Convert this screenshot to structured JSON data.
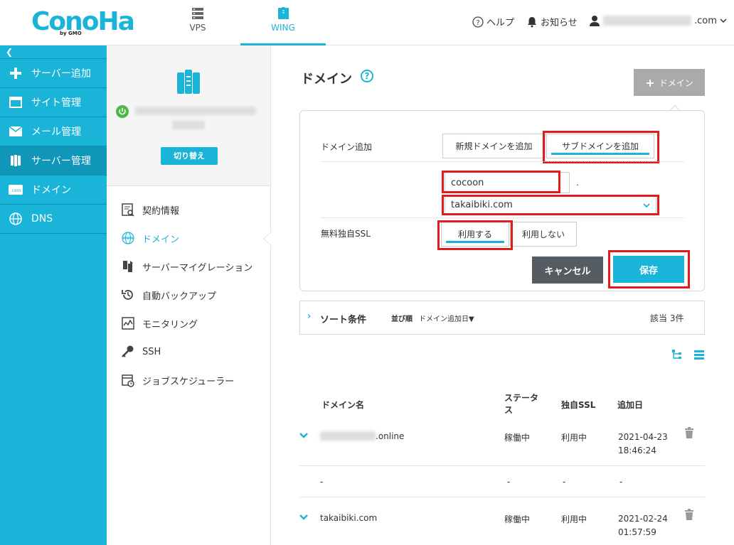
{
  "header": {
    "tabs": [
      {
        "label": "VPS",
        "icon": "server-icon",
        "active": false
      },
      {
        "label": "WING",
        "icon": "wing-server-icon",
        "active": true
      }
    ],
    "help_label": "ヘルプ",
    "notice_label": "お知らせ",
    "account_suffix": ".com",
    "accent_color": "#1ab4d8"
  },
  "logo": {
    "text": "ConoHa",
    "by": "by GMO"
  },
  "sidebar": {
    "items": [
      {
        "label": "サーバー追加",
        "icon": "plus-icon"
      },
      {
        "label": "サイト管理",
        "icon": "window-icon"
      },
      {
        "label": "メール管理",
        "icon": "mail-icon"
      },
      {
        "label": "サーバー管理",
        "icon": "server-manage-icon",
        "active": true
      },
      {
        "label": "ドメイン",
        "icon": "domain-icon"
      },
      {
        "label": "DNS",
        "icon": "globe-icon"
      }
    ]
  },
  "subpanel": {
    "switch_label": "切り替え",
    "items": [
      {
        "label": "契約情報",
        "icon": "contract-icon"
      },
      {
        "label": "ドメイン",
        "icon": "www-icon",
        "active": true
      },
      {
        "label": "サーバーマイグレーション",
        "icon": "migration-icon"
      },
      {
        "label": "自動バックアップ",
        "icon": "backup-icon"
      },
      {
        "label": "モニタリング",
        "icon": "monitoring-icon"
      },
      {
        "label": "SSH",
        "icon": "key-icon"
      },
      {
        "label": "ジョブスケジューラー",
        "icon": "scheduler-icon"
      }
    ]
  },
  "main": {
    "title": "ドメイン",
    "add_button": "ドメイン",
    "form": {
      "domain_add_label": "ドメイン追加",
      "option_new": "新規ドメインを追加",
      "option_sub": "サブドメインを追加",
      "subdomain_value": "cocoon",
      "dot": ".",
      "parent_domain_value": "takaibiki.com",
      "ssl_label": "無料独自SSL",
      "ssl_use": "利用する",
      "ssl_nouse": "利用しない",
      "cancel": "キャンセル",
      "save": "保存"
    },
    "sort": {
      "title": "ソート条件",
      "order_label": "並び順",
      "order_value": "ドメイン追加日▼",
      "count": "該当 3件"
    },
    "table": {
      "headers": [
        "ドメイン名",
        "ステータス",
        "独自SSL",
        "追加日"
      ],
      "rows": [
        {
          "name_suffix": ".online",
          "status": "稼働中",
          "ssl": "利用中",
          "date": "2021-04-23",
          "time": "18:46:24",
          "expandable": true,
          "deletable": true
        },
        {
          "name": "-",
          "status": "-",
          "ssl": "-",
          "date": "-",
          "time": "",
          "expandable": false,
          "deletable": false
        },
        {
          "name": "takaibiki.com",
          "status": "稼働中",
          "ssl": "利用中",
          "date": "2021-02-24",
          "time": "01:57:59",
          "expandable": true,
          "deletable": true
        }
      ]
    }
  }
}
